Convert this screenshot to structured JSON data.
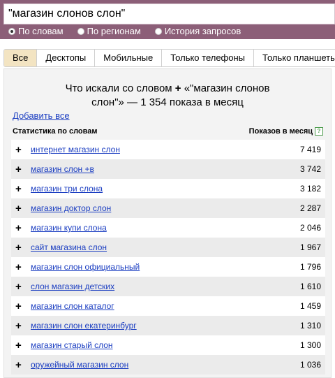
{
  "search": {
    "query": "\"магазин слонов слон\""
  },
  "modes": [
    {
      "label": "По словам",
      "selected": true
    },
    {
      "label": "По регионам",
      "selected": false
    },
    {
      "label": "История запросов",
      "selected": false
    }
  ],
  "tabs": [
    "Все",
    "Десктопы",
    "Мобильные",
    "Только телефоны",
    "Только планшеты"
  ],
  "header": {
    "line1_prefix": "Что искали со словом",
    "line1_suffix": "«\"магазин слонов",
    "line2": "слон\"» — 1 354 показа в месяц",
    "add_all": "Добавить все",
    "col_left": "Статистика по словам",
    "col_right": "Показов в месяц",
    "help_glyph": "?"
  },
  "rows": [
    {
      "phrase": "интернет магазин слон",
      "count": "7 419"
    },
    {
      "phrase": "магазин слон +в",
      "count": "3 742"
    },
    {
      "phrase": "магазин три слона",
      "count": "3 182"
    },
    {
      "phrase": "магазин доктор слон",
      "count": "2 287"
    },
    {
      "phrase": "магазин купи слона",
      "count": "2 046"
    },
    {
      "phrase": "сайт магазина слон",
      "count": "1 967"
    },
    {
      "phrase": "магазин слон официальный",
      "count": "1 796"
    },
    {
      "phrase": "слон магазин детских",
      "count": "1 610"
    },
    {
      "phrase": "магазин слон каталог",
      "count": "1 459"
    },
    {
      "phrase": "магазин слон екатеринбург",
      "count": "1 310"
    },
    {
      "phrase": "магазин старый слон",
      "count": "1 300"
    },
    {
      "phrase": "оружейный магазин слон",
      "count": "1 036"
    }
  ],
  "colors": {
    "topbar": "#8c5f78",
    "link": "#1a3dc1",
    "active_tab": "#f3e4c2"
  }
}
